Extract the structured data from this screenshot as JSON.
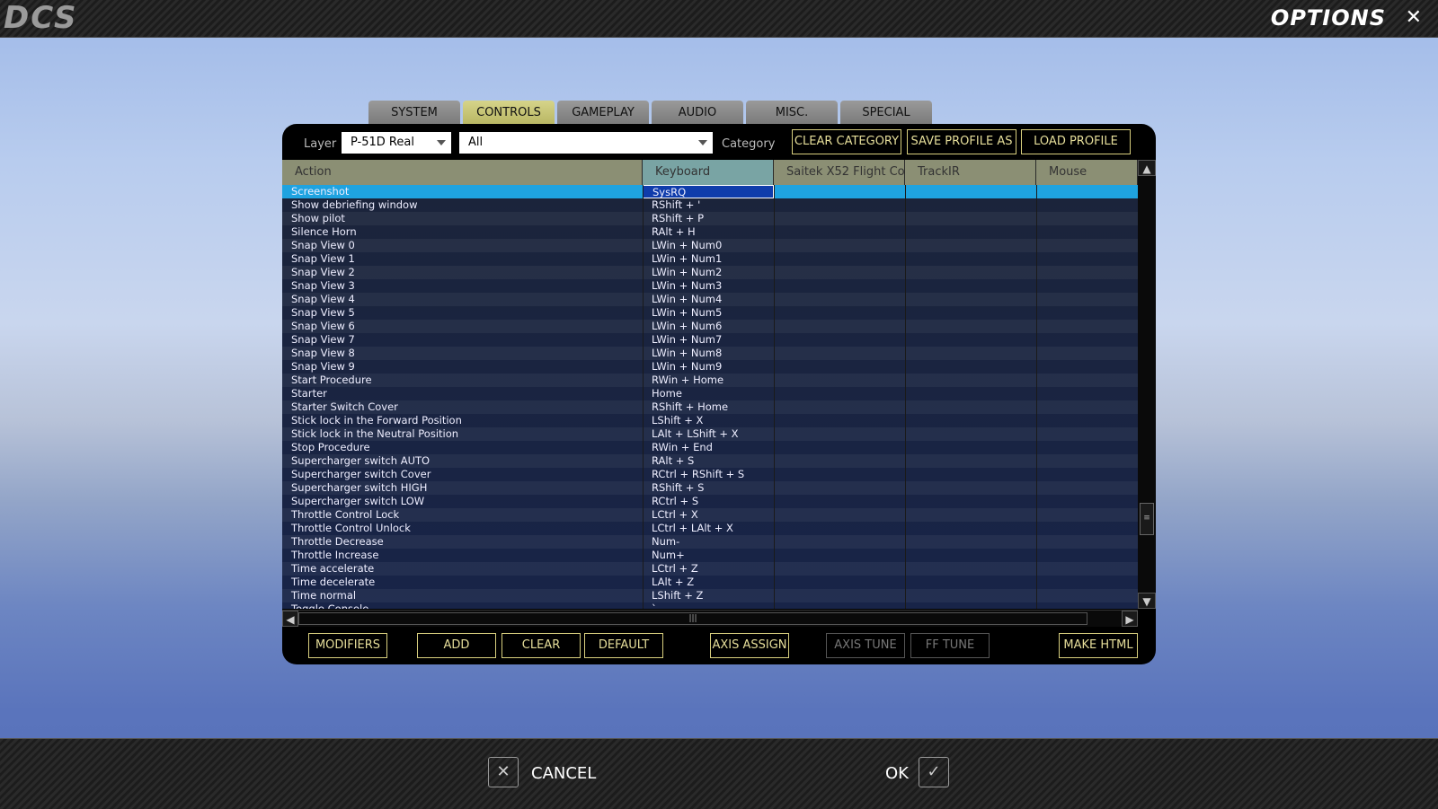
{
  "window": {
    "logo": "DCS",
    "title": "OPTIONS"
  },
  "tabs": [
    {
      "label": "SYSTEM",
      "active": false
    },
    {
      "label": "CONTROLS",
      "active": true
    },
    {
      "label": "GAMEPLAY",
      "active": false
    },
    {
      "label": "AUDIO",
      "active": false
    },
    {
      "label": "MISC.",
      "active": false
    },
    {
      "label": "SPECIAL",
      "active": false
    }
  ],
  "toolbar": {
    "layer_label": "Layer",
    "layer_value": "P-51D Real",
    "category_value": "All",
    "category_label": "Category",
    "clear_category": "CLEAR CATEGORY",
    "save_profile_as": "SAVE PROFILE AS",
    "load_profile": "LOAD PROFILE"
  },
  "table": {
    "columns": [
      "Action",
      "Keyboard",
      "Saitek X52 Flight Co",
      "TrackIR",
      "Mouse"
    ],
    "selected_index": 0,
    "rows": [
      [
        "Screenshot",
        "SysRQ"
      ],
      [
        "Show debriefing window",
        "RShift + '"
      ],
      [
        "Show pilot",
        "RShift + P"
      ],
      [
        "Silence Horn",
        "RAlt + H"
      ],
      [
        "Snap View 0",
        "LWin + Num0"
      ],
      [
        "Snap View 1",
        "LWin + Num1"
      ],
      [
        "Snap View 2",
        "LWin + Num2"
      ],
      [
        "Snap View 3",
        "LWin + Num3"
      ],
      [
        "Snap View 4",
        "LWin + Num4"
      ],
      [
        "Snap View 5",
        "LWin + Num5"
      ],
      [
        "Snap View 6",
        "LWin + Num6"
      ],
      [
        "Snap View 7",
        "LWin + Num7"
      ],
      [
        "Snap View 8",
        "LWin + Num8"
      ],
      [
        "Snap View 9",
        "LWin + Num9"
      ],
      [
        "Start Procedure",
        "RWin + Home"
      ],
      [
        "Starter",
        "Home"
      ],
      [
        "Starter Switch Cover",
        "RShift + Home"
      ],
      [
        "Stick lock in the Forward Position",
        "LShift + X"
      ],
      [
        "Stick lock in the Neutral Position",
        "LAlt + LShift + X"
      ],
      [
        "Stop Procedure",
        "RWin + End"
      ],
      [
        "Supercharger switch AUTO",
        "RAlt + S"
      ],
      [
        "Supercharger switch Cover",
        "RCtrl + RShift + S"
      ],
      [
        "Supercharger switch HIGH",
        "RShift + S"
      ],
      [
        "Supercharger switch LOW",
        "RCtrl + S"
      ],
      [
        "Throttle Control Lock",
        "LCtrl + X"
      ],
      [
        "Throttle Control Unlock",
        "LCtrl + LAlt + X"
      ],
      [
        "Throttle Decrease",
        "Num-"
      ],
      [
        "Throttle Increase",
        "Num+"
      ],
      [
        "Time accelerate",
        "LCtrl + Z"
      ],
      [
        "Time decelerate",
        "LAlt + Z"
      ],
      [
        "Time normal",
        "LShift + Z"
      ],
      [
        "Toggle Console",
        "`"
      ]
    ]
  },
  "buttons": {
    "modifiers": "MODIFIERS",
    "add": "ADD",
    "clear": "CLEAR",
    "default": "DEFAULT",
    "axis_assign": "AXIS ASSIGN",
    "axis_tune": "AXIS TUNE",
    "ff_tune": "FF TUNE",
    "make_html": "MAKE HTML"
  },
  "footer": {
    "cancel": "CANCEL",
    "ok": "OK"
  },
  "icons": {
    "close": "close-icon",
    "cancel": "x-icon",
    "ok": "check-icon"
  }
}
